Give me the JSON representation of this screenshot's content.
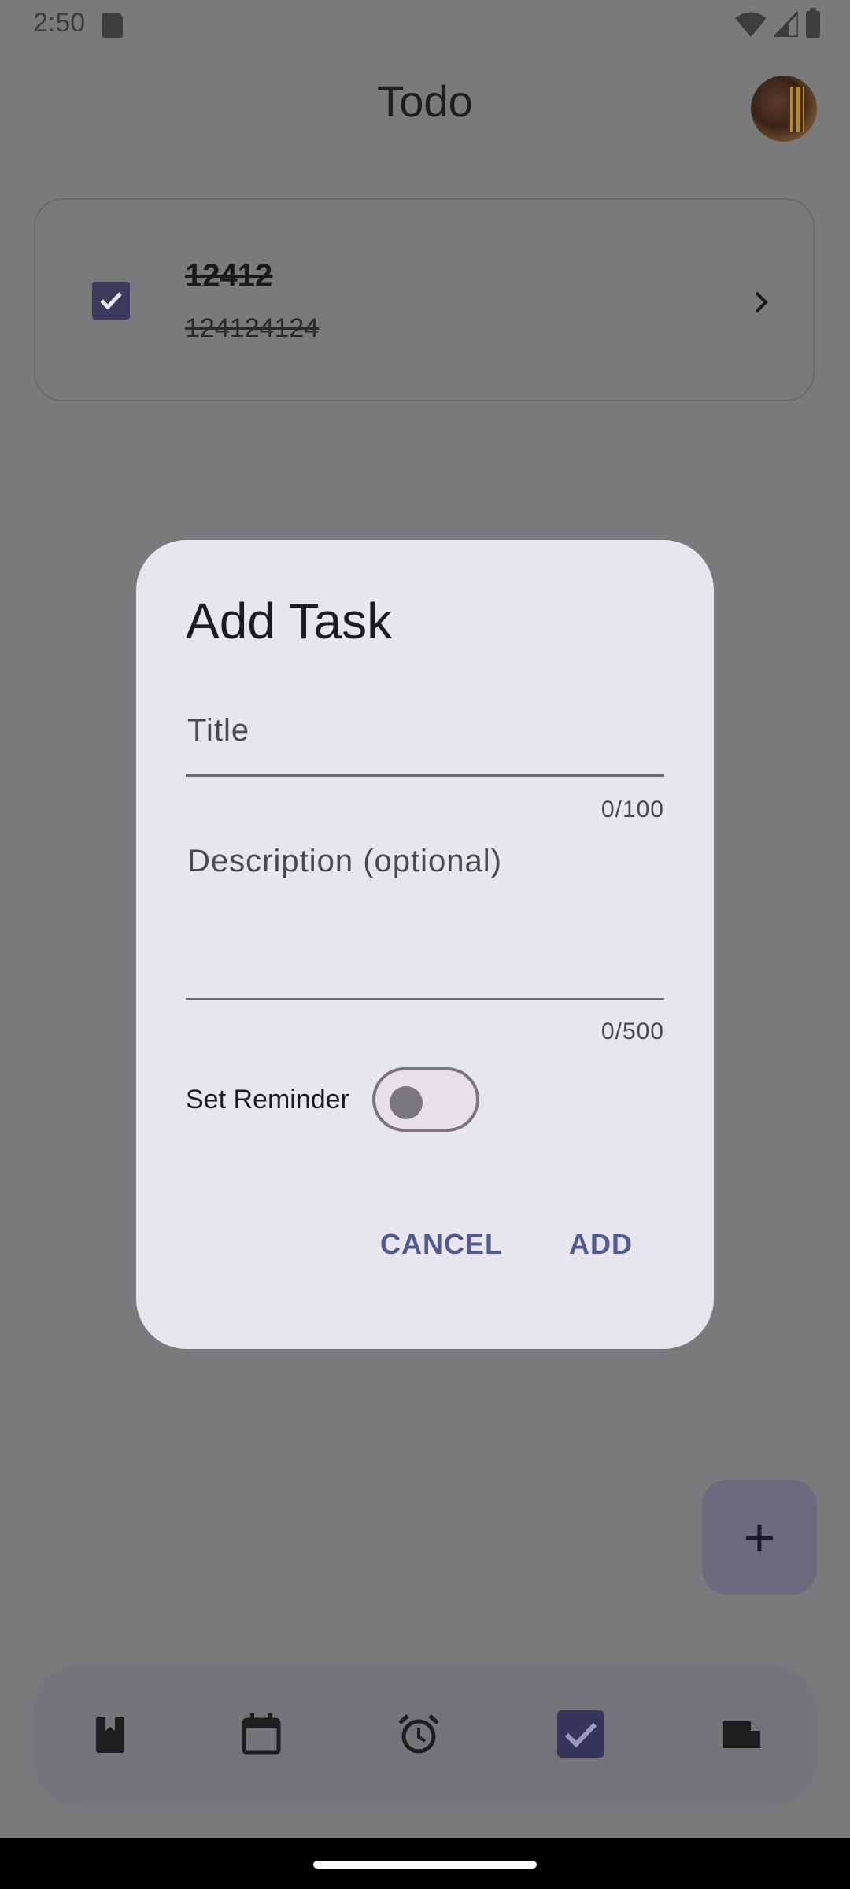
{
  "status_bar": {
    "time": "2:50"
  },
  "app": {
    "title": "Todo"
  },
  "tasks": [
    {
      "title": "12412",
      "description": "124124124",
      "completed": true
    }
  ],
  "fab": {
    "icon": "plus-icon",
    "label": "+"
  },
  "bottom_nav": {
    "items": [
      {
        "icon": "bookmark-book-icon"
      },
      {
        "icon": "calendar-icon"
      },
      {
        "icon": "alarm-icon"
      },
      {
        "icon": "checkbox-icon",
        "active": true
      },
      {
        "icon": "note-icon"
      }
    ]
  },
  "dialog": {
    "title": "Add Task",
    "title_placeholder": "Title",
    "title_counter": "0/100",
    "description_placeholder": "Description (optional)",
    "description_counter": "0/500",
    "reminder_label": "Set Reminder",
    "reminder_on": false,
    "cancel_label": "CANCEL",
    "add_label": "ADD"
  },
  "colors": {
    "scrim": "#7a797b",
    "dialog_bg": "#e8e5ec",
    "accent": "#4f5a92"
  }
}
